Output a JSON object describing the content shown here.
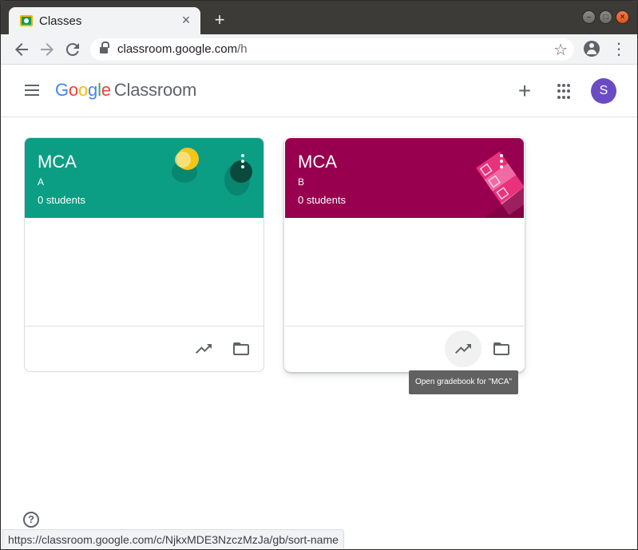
{
  "browser": {
    "tab_title": "Classes",
    "tab_close": "×",
    "new_tab": "+",
    "url_host": "classroom.google.com",
    "url_path": "/h",
    "status_url": "https://classroom.google.com/c/NjkxMDE3NzczMzJa/gb/sort-name"
  },
  "app": {
    "logo": {
      "g1": "G",
      "g2": "o",
      "g3": "o",
      "g4": "g",
      "g5": "l",
      "g6": "e",
      "product": "Classroom"
    },
    "avatar_letter": "S",
    "plus": "+"
  },
  "cards": [
    {
      "title": "MCA",
      "section": "A",
      "students": "0 students",
      "color": "#0b9e84"
    },
    {
      "title": "MCA",
      "section": "B",
      "students": "0 students",
      "color": "#98004f"
    }
  ],
  "tooltip": "Open gradebook for \"MCA\"",
  "help": "?",
  "colors": {
    "teal": "#0b9e84",
    "magenta": "#98004f",
    "avatar": "#6b4bc4"
  }
}
